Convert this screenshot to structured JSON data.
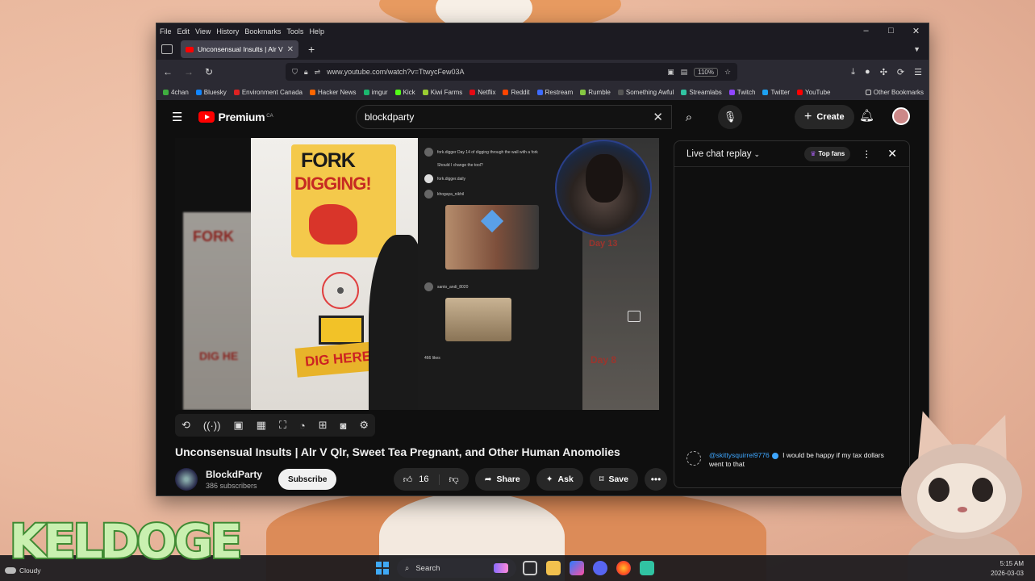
{
  "menu": [
    "File",
    "Edit",
    "View",
    "History",
    "Bookmarks",
    "Tools",
    "Help"
  ],
  "window_controls": {
    "minimize": "–",
    "maximize": "□",
    "close": "✕"
  },
  "tab": {
    "title": "Unconsensual Insults | Alr V Qlr",
    "close": "✕",
    "new_tab": "+"
  },
  "nav": {
    "back": "←",
    "forward": "→",
    "reload": "↻",
    "url": "www.youtube.com/watch?v=TtwycFew03A",
    "zoom": "110%"
  },
  "bookmarks": [
    {
      "label": "4chan",
      "color": "#3fae3f"
    },
    {
      "label": "Bluesky",
      "color": "#1185fe"
    },
    {
      "label": "Environment Canada",
      "color": "#d22"
    },
    {
      "label": "Hacker News",
      "color": "#ff6600"
    },
    {
      "label": "imgur",
      "color": "#1bb76e"
    },
    {
      "label": "Kick",
      "color": "#53fc18"
    },
    {
      "label": "Kiwi Farms",
      "color": "#9acd32"
    },
    {
      "label": "Netflix",
      "color": "#e50914"
    },
    {
      "label": "Reddit",
      "color": "#ff4500"
    },
    {
      "label": "Restream",
      "color": "#3d6bff"
    },
    {
      "label": "Rumble",
      "color": "#85c742"
    },
    {
      "label": "Something Awful",
      "color": "#222222"
    },
    {
      "label": "Streamlabs",
      "color": "#31c3a2"
    },
    {
      "label": "Twitch",
      "color": "#9146ff"
    },
    {
      "label": "Twitter",
      "color": "#1da1f2"
    },
    {
      "label": "YouTube",
      "color": "#ff0000"
    }
  ],
  "other_bookmarks": "Other Bookmarks",
  "youtube": {
    "logo_word": "Premium",
    "region": "CA",
    "search_value": "blockdparty",
    "create_label": "Create",
    "video": {
      "title": "Unconsensual Insults | Alr V Qlr, Sweet Tea Pregnant, and Other Human Anomolies",
      "sign_line1": "FORK",
      "sign_line2": "DIGGING!",
      "dig_here": "DIG HERE!",
      "left_sign": "FORK",
      "left_bottom": "DIG HE",
      "right_day13": "Day 13",
      "right_day8": "Day 8",
      "phone_comments": [
        "fork.digger Day 14 of digging through the wall with a fork",
        "Should I change the tool?",
        "fork.digger.daily",
        "khogaya_nikhil",
        "santo_andi_8020",
        "466 likes"
      ]
    },
    "channel": {
      "name": "BlockdParty",
      "subscribers": "386 subscribers",
      "subscribe_label": "Subscribe"
    },
    "actions": {
      "likes": "16",
      "share": "Share",
      "ask": "Ask",
      "save": "Save"
    },
    "chat": {
      "title": "Live chat replay",
      "top_fans": "Top fans",
      "message": {
        "author": "@skittysquirrel9776",
        "text": "I would be happy if my tax dollars went to that"
      }
    }
  },
  "overlay": {
    "brand": "KELDOGE"
  },
  "taskbar": {
    "weather": "Cloudy",
    "search_placeholder": "Search",
    "time": "5:15 AM",
    "date": "2026-03-03"
  }
}
